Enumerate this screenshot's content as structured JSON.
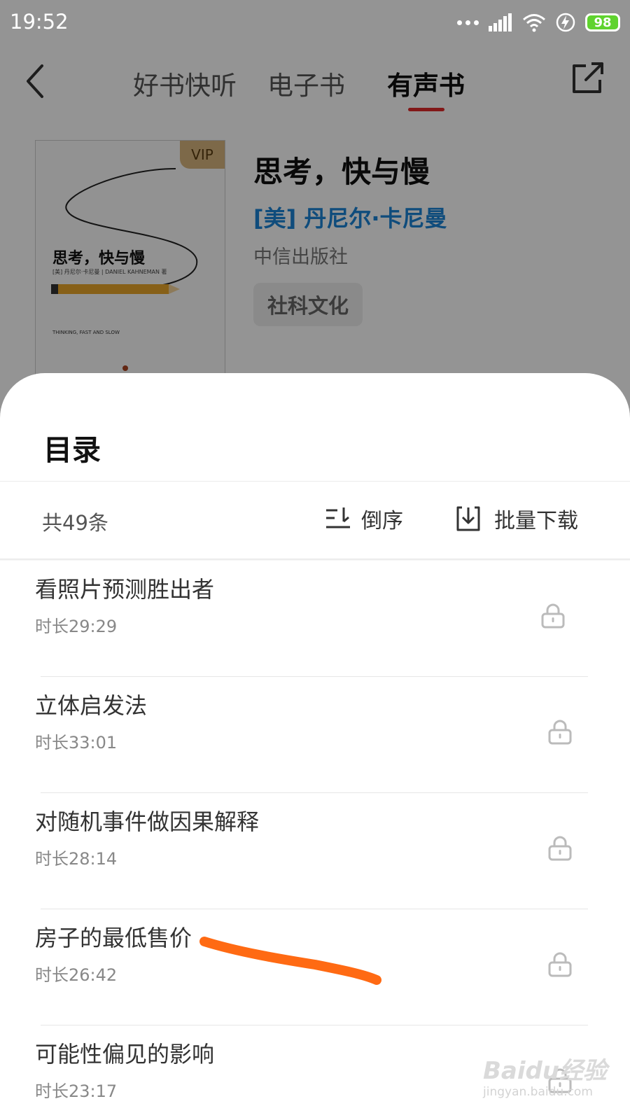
{
  "status_bar": {
    "time": "19:52",
    "battery": "98"
  },
  "nav": {
    "tabs": [
      {
        "label": "好书快听",
        "active": false
      },
      {
        "label": "电子书",
        "active": false
      },
      {
        "label": "有声书",
        "active": true
      }
    ]
  },
  "book": {
    "cover_badge": "VIP",
    "cover_title": "思考，快与慢",
    "cover_subtitle": "[美] 丹尼尔·卡尼曼 | DANIEL KAHNEMAN 著",
    "cover_subtitle2": "THINKING, FAST AND SLOW",
    "title": "思考，快与慢",
    "author": "[美] 丹尼尔·卡尼曼",
    "publisher": "中信出版社",
    "category": "社科文化"
  },
  "sheet": {
    "title": "目录",
    "count": "共49条",
    "sort_label": "倒序",
    "download_label": "批量下载",
    "chapters": [
      {
        "title": "看照片预测胜出者",
        "duration": "时长29:29"
      },
      {
        "title": "立体启发法",
        "duration": "时长33:01"
      },
      {
        "title": "对随机事件做因果解释",
        "duration": "时长28:14"
      },
      {
        "title": "房子的最低售价",
        "duration": "时长26:42"
      },
      {
        "title": "可能性偏见的影响",
        "duration": "时长23:17"
      }
    ]
  },
  "watermark": {
    "main": "Baidu经验",
    "sub": "jingyan.baidu.com"
  },
  "colors": {
    "accent": "#e02a2a",
    "author": "#1a84d6",
    "annotation": "#ff6a13",
    "battery": "#5fd32e"
  }
}
